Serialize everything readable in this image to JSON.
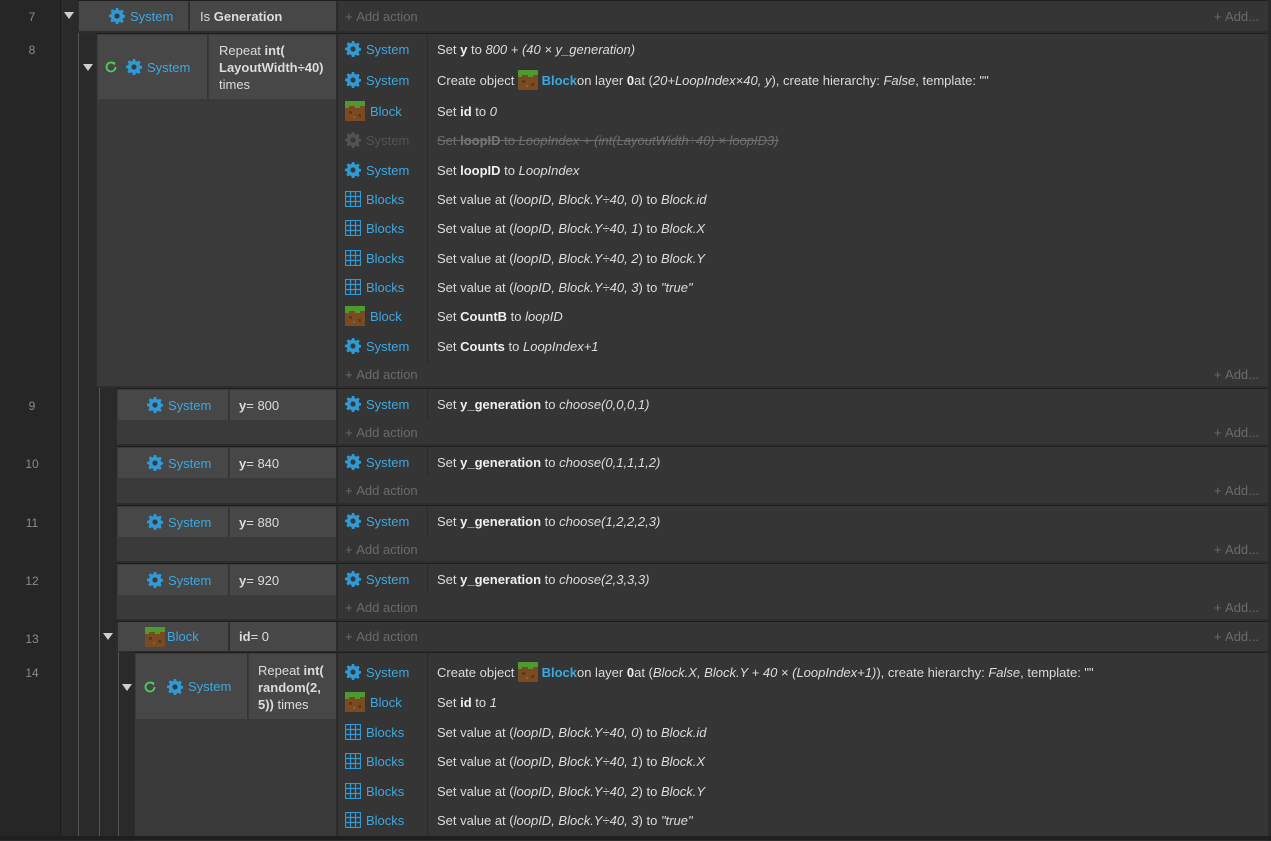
{
  "rows": {
    "r7": "7",
    "r8": "8",
    "r9": "9",
    "r10": "10",
    "r11": "11",
    "r12": "12",
    "r13": "13",
    "r14": "14"
  },
  "common": {
    "system": "System",
    "block": "Block",
    "blocks": "Blocks",
    "add_action": "Add action",
    "add_right": "Add..."
  },
  "ev7": {
    "cond_prefix": "Is ",
    "cond_bold": "Generation"
  },
  "ev8": {
    "repeat": "Repeat ",
    "repeat_expr": "int(",
    "repeat_expr2": "LayoutWidth÷40)",
    "repeat_suffix": "times",
    "a1": {
      "pre": "Set ",
      "b": "y",
      "mid": " to ",
      "i": "800 + (40 × y_generation)"
    },
    "a2": {
      "pre": "Create object ",
      "obj": "Block",
      "mid": " on layer ",
      "layer": "0",
      "at": " at (",
      "i1": "20+LoopIndex×40, y",
      "post": "), create hierarchy: ",
      "i2": "False",
      "post2": ", template: \"\""
    },
    "a3": {
      "pre": "Set ",
      "b": "id",
      "mid": " to ",
      "i": "0"
    },
    "a4": {
      "pre": "Set ",
      "b": "loopID",
      "mid": " to ",
      "i": "LoopIndex + (int(LayoutWidth÷40) × loopID3)"
    },
    "a5": {
      "pre": "Set ",
      "b": "loopID",
      "mid": " to ",
      "i": "LoopIndex"
    },
    "a6": {
      "pre": "Set value at (",
      "i1": "loopID, Block.Y÷40, 0",
      "mid": ") to ",
      "i2": "Block.id"
    },
    "a7": {
      "pre": "Set value at (",
      "i1": "loopID, Block.Y÷40, 1",
      "mid": ") to ",
      "i2": "Block.X"
    },
    "a8": {
      "pre": "Set value at (",
      "i1": "loopID, Block.Y÷40, 2",
      "mid": ") to ",
      "i2": "Block.Y"
    },
    "a9": {
      "pre": "Set value at (",
      "i1": "loopID, Block.Y÷40, 3",
      "mid": ") to ",
      "i2": "\"true\""
    },
    "a10": {
      "pre": "Set ",
      "b": "CountB",
      "mid": " to ",
      "i": "loopID"
    },
    "a11": {
      "pre": "Set ",
      "b": "Counts",
      "mid": " to ",
      "i": "LoopIndex+1"
    }
  },
  "ev9": {
    "var": "y",
    "cond": " = 800",
    "pre": "Set ",
    "b": "y_generation",
    "mid": " to ",
    "i": "choose(0,0,0,1)"
  },
  "ev10": {
    "var": "y",
    "cond": " = 840",
    "pre": "Set ",
    "b": "y_generation",
    "mid": " to ",
    "i": "choose(0,1,1,1,2)"
  },
  "ev11": {
    "var": "y",
    "cond": " = 880",
    "pre": "Set ",
    "b": "y_generation",
    "mid": " to ",
    "i": "choose(1,2,2,2,3)"
  },
  "ev12": {
    "var": "y",
    "cond": " = 920",
    "pre": "Set ",
    "b": "y_generation",
    "mid": " to ",
    "i": "choose(2,3,3,3)"
  },
  "ev13": {
    "var": "id",
    "cond": " = 0"
  },
  "ev14": {
    "repeat": "Repeat ",
    "repeat_expr": "int(",
    "repeat_expr2": "random(2,",
    "repeat_expr3": "5))",
    "repeat_suffix": " times",
    "a1": {
      "pre": "Create object ",
      "obj": "Block",
      "mid": " on layer ",
      "layer": "0",
      "at": " at (",
      "i1": "Block.X, Block.Y + 40 × (LoopIndex+1)",
      "post": "), create hierarchy: ",
      "i2": "False",
      "post2": ", template: \"\""
    },
    "a2": {
      "pre": "Set ",
      "b": "id",
      "mid": " to ",
      "i": "1"
    },
    "a3": {
      "pre": "Set value at (",
      "i1": "loopID, Block.Y÷40, 0",
      "mid": ") to ",
      "i2": "Block.id"
    },
    "a4": {
      "pre": "Set value at (",
      "i1": "loopID, Block.Y÷40, 1",
      "mid": ") to ",
      "i2": "Block.X"
    },
    "a5": {
      "pre": "Set value at (",
      "i1": "loopID, Block.Y÷40, 2",
      "mid": ") to ",
      "i2": "Block.Y"
    },
    "a6": {
      "pre": "Set value at (",
      "i1": "loopID, Block.Y÷40, 3",
      "mid": ") to ",
      "i2": "\"true\""
    }
  },
  "colors": {
    "link": "#3da8e0",
    "gear": "#2f9ad6",
    "loop": "#4ccf5a",
    "grid": "#2f9ad6"
  }
}
